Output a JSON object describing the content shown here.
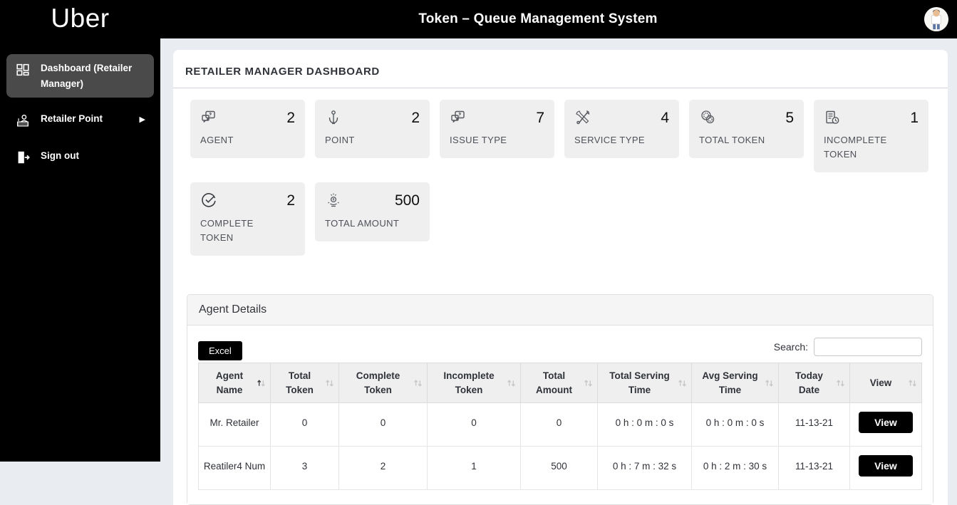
{
  "colors": {
    "header_bg": "#000000",
    "sidebar_bg": "#000000",
    "active_item_bg": "#4a4a4a",
    "page_bg": "#e9ecf1",
    "stat_card_bg": "#efefef",
    "button_bg": "#000000",
    "button_text": "#ffffff"
  },
  "header": {
    "brand": "Uber",
    "title": "Token – Queue Management System",
    "avatar_icon": "user-avatar"
  },
  "sidebar": {
    "items": [
      {
        "label": "Dashboard (Retailer Manager)",
        "icon": "dashboard-grid-icon",
        "active": true
      },
      {
        "label": "Retailer Point",
        "icon": "retailer-point-icon",
        "has_submenu": true
      },
      {
        "label": "Sign out",
        "icon": "sign-out-icon"
      }
    ]
  },
  "page": {
    "title": "RETAILER MANAGER DASHBOARD"
  },
  "stats": [
    {
      "label": "AGENT",
      "value": "2",
      "icon": "agent-chat-icon"
    },
    {
      "label": "POINT",
      "value": "2",
      "icon": "point-pen-icon"
    },
    {
      "label": "ISSUE TYPE",
      "value": "7",
      "icon": "issue-type-chat-icon"
    },
    {
      "label": "SERVICE TYPE",
      "value": "4",
      "icon": "service-tools-icon"
    },
    {
      "label": "TOTAL TOKEN",
      "value": "5",
      "icon": "coins-icon"
    },
    {
      "label": "INCOMPLETE\nTOKEN",
      "value": "1",
      "icon": "document-clock-icon"
    },
    {
      "label": "COMPLETE\nTOKEN",
      "value": "2",
      "icon": "check-circle-icon"
    },
    {
      "label": "TOTAL AMOUNT",
      "value": "500",
      "icon": "money-icon"
    }
  ],
  "agent_details": {
    "title": "Agent Details",
    "excel_button": "Excel",
    "search_label": "Search:",
    "search_value": "",
    "table": {
      "columns": [
        "Agent Name",
        "Total Token",
        "Complete Token",
        "Incomplete Token",
        "Total Amount",
        "Total Serving Time",
        "Avg Serving Time",
        "Today Date",
        "View"
      ],
      "rows": [
        {
          "agent_name": "Mr. Retailer",
          "total_token": "0",
          "complete_token": "0",
          "incomplete_token": "0",
          "total_amount": "0",
          "total_serving_time": "0 h : 0 m : 0 s",
          "avg_serving_time": "0 h : 0 m : 0 s",
          "today_date": "11-13-21",
          "view_label": "View"
        },
        {
          "agent_name": "Reatiler4 Num",
          "total_token": "3",
          "complete_token": "2",
          "incomplete_token": "1",
          "total_amount": "500",
          "total_serving_time": "0 h : 7 m : 32 s",
          "avg_serving_time": "0 h : 2 m : 30 s",
          "today_date": "11-13-21",
          "view_label": "View"
        }
      ]
    }
  }
}
